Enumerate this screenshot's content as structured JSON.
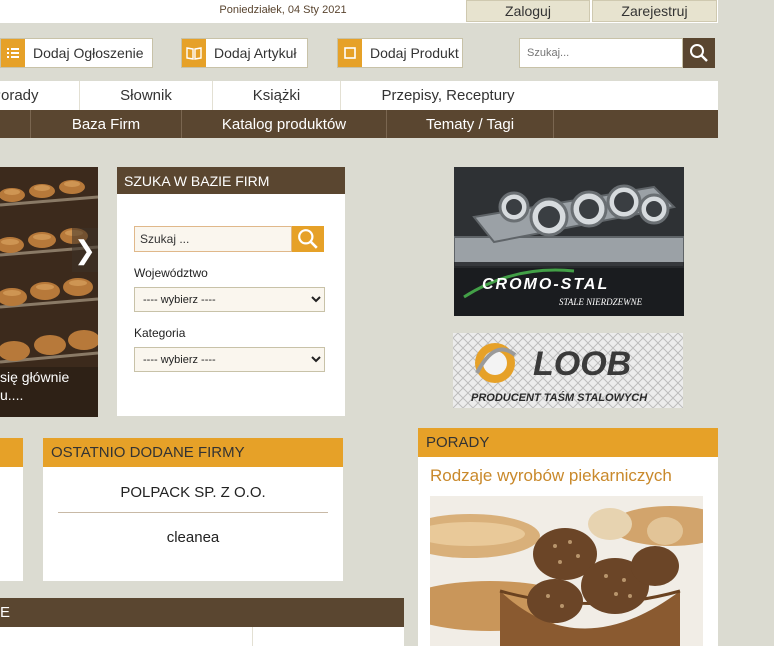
{
  "header": {
    "date": "Poniedziałek, 04 Sty 2021",
    "login_label": "Zaloguj",
    "register_label": "Zarejestruj"
  },
  "actions": {
    "add_ad": "Dodaj Ogłoszenie",
    "add_article": "Dodaj Artykuł",
    "add_product": "Dodaj Produkt"
  },
  "search": {
    "placeholder": "Szukaj..."
  },
  "nav_primary": [
    "Porady",
    "Słownik",
    "Książki",
    "Przepisy, Receptury"
  ],
  "nav_secondary": [
    "Baza Firm",
    "Katalog produktów",
    "Tematy / Tagi"
  ],
  "slider": {
    "caption_line1": "się głównie",
    "caption_line2": "u....",
    "arrow": "❯"
  },
  "firm_search": {
    "title": "SZUKA W BAZIE FIRM",
    "input_value": "Szukaj ...",
    "region_label": "Województwo",
    "region_value": "---- wybierz ----",
    "category_label": "Kategoria",
    "category_value": "---- wybierz ----"
  },
  "ads": {
    "cromo_name": "CROMO-STAL",
    "cromo_tagline": "STALE NIERDZEWNE",
    "loob_name": "LOOB",
    "loob_tagline": "PRODUCENT TAŚM STALOWYCH"
  },
  "latest_firms": {
    "title": "OSTATNIO DODANE FIRMY",
    "items": [
      "POLPACK SP. Z O.O.",
      "cleanea"
    ]
  },
  "bottom_section": {
    "title": "E"
  },
  "advice": {
    "title": "PORADY",
    "article_title": "Rodzaje wyrobów piekarniczych"
  },
  "colors": {
    "brown": "#5a4630",
    "orange": "#e6a128",
    "background": "#dbdbd1"
  }
}
